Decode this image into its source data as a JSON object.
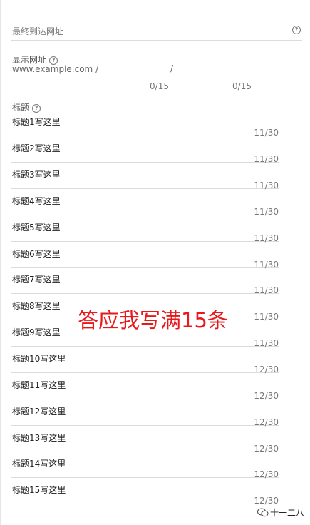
{
  "final_url": {
    "label": "最终到达网址"
  },
  "display_url": {
    "label": "显示网址",
    "base": "www.example.com /",
    "separator": "/",
    "path1_counter": "0/15",
    "path2_counter": "0/15"
  },
  "headlines": {
    "label": "标题",
    "items": [
      {
        "text": "标题1写这里",
        "count": "11/30"
      },
      {
        "text": "标题2写这里",
        "count": "11/30"
      },
      {
        "text": "标题3写这里",
        "count": "11/30"
      },
      {
        "text": "标题4写这里",
        "count": "11/30"
      },
      {
        "text": "标题5写这里",
        "count": "11/30"
      },
      {
        "text": "标题6写这里",
        "count": "11/30"
      },
      {
        "text": "标题7写这里",
        "count": "11/30"
      },
      {
        "text": "标题8写这里",
        "count": "11/30"
      },
      {
        "text": "标题9写这里",
        "count": "11/30"
      },
      {
        "text": "标题10写这里",
        "count": "12/30"
      },
      {
        "text": "标题11写这里",
        "count": "12/30"
      },
      {
        "text": "标题12写这里",
        "count": "12/30"
      },
      {
        "text": "标题13写这里",
        "count": "12/30"
      },
      {
        "text": "标题14写这里",
        "count": "12/30"
      },
      {
        "text": "标题15写这里",
        "count": "12/30"
      }
    ]
  },
  "overlay_text": "答应我写满15条",
  "watermark": {
    "text": "十一二八",
    "icon": "wechat-icon"
  },
  "colors": {
    "overlay": "#e8181b",
    "divider": "#dadce0",
    "muted": "#777777"
  }
}
